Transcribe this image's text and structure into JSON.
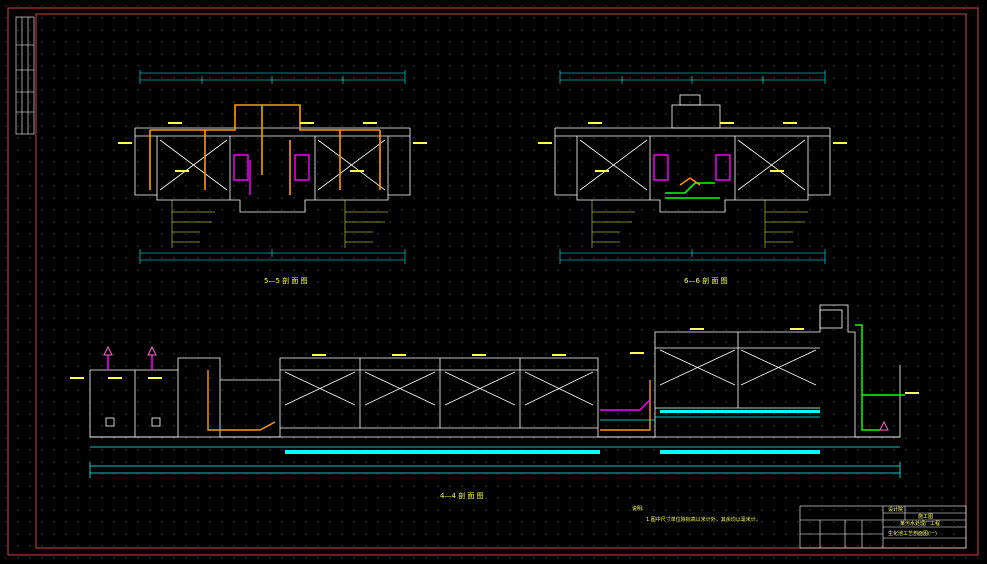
{
  "drawing": {
    "section_a_title": "5—5 剖 面 图",
    "section_b_title": "6—6 剖 面 图",
    "section_c_title": "4—4 剖 面 图",
    "notes_heading": "说明:",
    "notes_text": "1.图中尺寸单位除标高以米计外，其余均以毫米计。",
    "title_block": {
      "company": "设计院",
      "project": "某污水处理厂工程",
      "drawing_name": "生化池工艺剖面图(一)",
      "sheet_label": "施工图"
    }
  },
  "colors": {
    "background": "#000000",
    "frame": "#d04040",
    "outline": "#ffffff",
    "dimension": "#00ffff",
    "pipe_orange": "#ff9900",
    "pipe_magenta": "#ff00ff",
    "pipe_green": "#00ff00",
    "text_yellow": "#ffff55"
  }
}
